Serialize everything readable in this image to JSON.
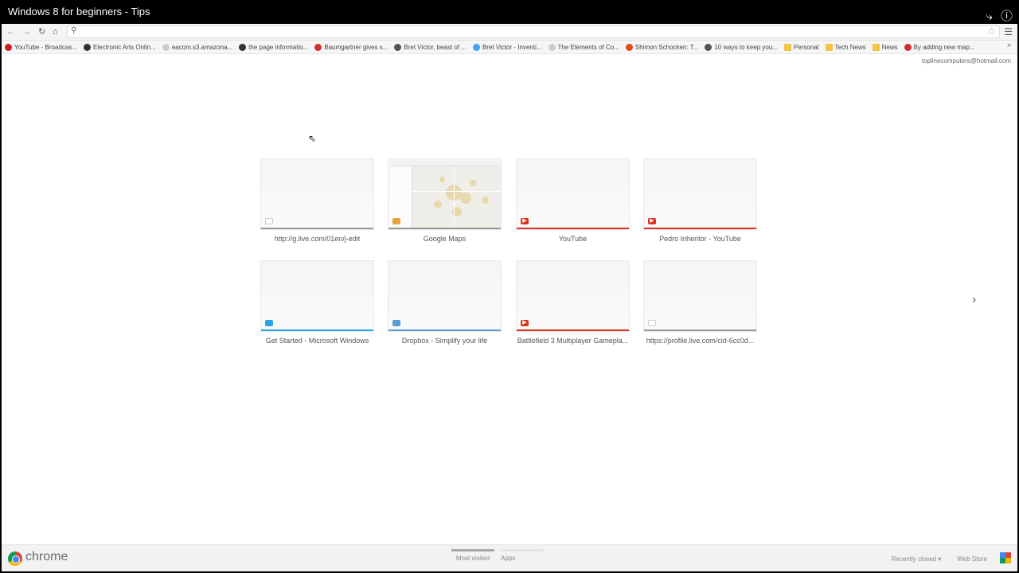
{
  "video": {
    "title": "Windows 8 for beginners - Tips",
    "share_icon": "share-icon",
    "info_icon": "info-icon"
  },
  "toolbar": {
    "back": "←",
    "forward": "→",
    "reload": "↻",
    "home": "⌂",
    "search": "🔍",
    "star": "☆",
    "menu": "☰"
  },
  "bookmarks": [
    {
      "label": "YouTube - Broadcas...",
      "color": "#cc1d1d"
    },
    {
      "label": "Electronic Arts Onlin...",
      "color": "#333333"
    },
    {
      "label": "eacom.s3.amazona...",
      "color": "#cccccc"
    },
    {
      "label": "the page informatio...",
      "color": "#333333"
    },
    {
      "label": "Baumgartner gives s...",
      "color": "#d32f2f"
    },
    {
      "label": "Bret Victor, beast of ...",
      "color": "#555555"
    },
    {
      "label": "Bret Victor - Inventi...",
      "color": "#42a5f5"
    },
    {
      "label": "The Elements of Co...",
      "color": "#cccccc"
    },
    {
      "label": "Shimon Schocken: T...",
      "color": "#e64a19"
    },
    {
      "label": "10 ways to keep you...",
      "color": "#555555"
    },
    {
      "label": "Personal",
      "color": "#f4c542"
    },
    {
      "label": "Tech News",
      "color": "#f4c542"
    },
    {
      "label": "News",
      "color": "#f4c542"
    },
    {
      "label": "By adding new map...",
      "color": "#d32f2f"
    }
  ],
  "bookmarks_more": "»",
  "account": "toplinecomputers@hotmail.com",
  "most_visited": [
    {
      "label": "http://g.live.com/01en/j-edit",
      "bar": "#999999",
      "icon": "page-icon",
      "icon_color": "#cccccc"
    },
    {
      "label": "Google Maps",
      "bar": "#999999",
      "icon": "maps-icon",
      "icon_color": "#e8a33d"
    },
    {
      "label": "YouTube",
      "bar": "#d9331f",
      "icon": "youtube-icon",
      "icon_color": "#d9331f"
    },
    {
      "label": "Pedro Inheritor - YouTube",
      "bar": "#d9331f",
      "icon": "youtube-icon",
      "icon_color": "#d9331f"
    },
    {
      "label": "Get Started - Microsoft Windows",
      "bar": "#29a3e8",
      "icon": "windows-icon",
      "icon_color": "#29a3e8"
    },
    {
      "label": "Dropbox - Simplify your life",
      "bar": "#5b9bd5",
      "icon": "dropbox-icon",
      "icon_color": "#5b9bd5"
    },
    {
      "label": "Battlefield 3 Multiplayer Gamepla...",
      "bar": "#d9331f",
      "icon": "youtube-icon",
      "icon_color": "#d9331f"
    },
    {
      "label": "https://profile.live.com/cid-6cc0d...",
      "bar": "#999999",
      "icon": "page-icon",
      "icon_color": "#cccccc"
    }
  ],
  "next_arrow": "›",
  "footer": {
    "brand": "chrome",
    "tabs": [
      "Most visited",
      "Apps"
    ],
    "recently_closed": "Recently closed ▾",
    "web_store": "Web Store"
  }
}
